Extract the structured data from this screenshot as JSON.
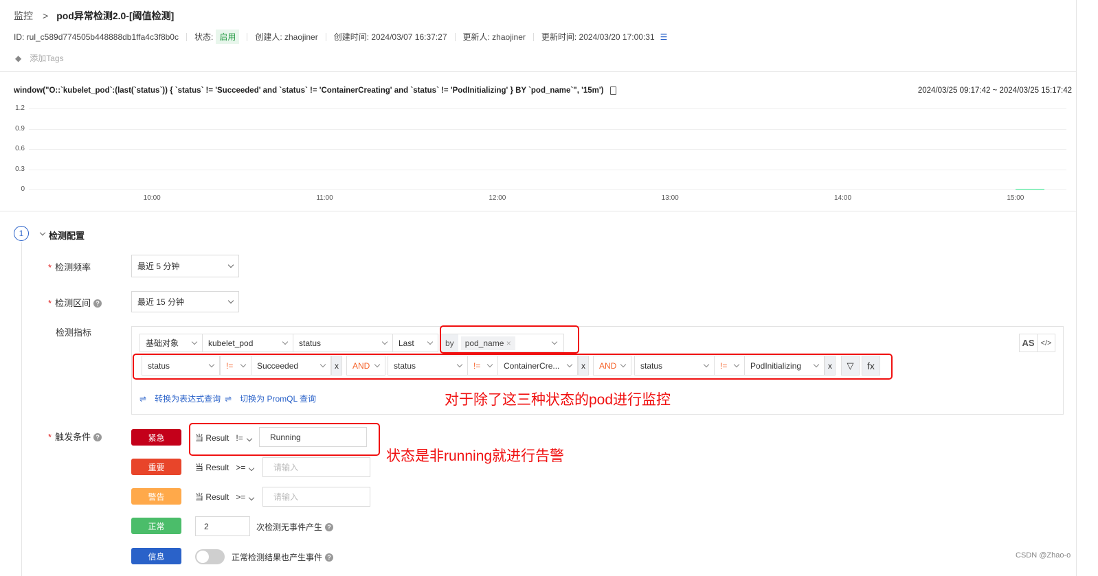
{
  "breadcrumb": {
    "parent": "监控",
    "separator": ">",
    "title": "pod异常检测2.0-[阈值检测]"
  },
  "meta": {
    "id": "ID: rul_c589d774505b448888db1ffa4c3f8b0c",
    "status_label": "状态:",
    "status_value": "启用",
    "creator": "创建人: zhaojiner",
    "created_time": "创建时间: 2024/03/07 16:37:27",
    "updater": "更新人: zhaojiner",
    "updated_time": "更新时间: 2024/03/20 17:00:31",
    "history_icon": "history-search-icon"
  },
  "tags": {
    "add_label": "添加Tags",
    "icon": "tag-icon"
  },
  "query": {
    "text": "window(\"O::`kubelet_pod`:(last(`status`)) { `status` != 'Succeeded' and `status` != 'ContainerCreating' and `status` != 'PodInitializing' } BY `pod_name`\", '15m')",
    "time_range": "2024/03/25 09:17:42 ~ 2024/03/25 15:17:42"
  },
  "chart_data": {
    "type": "line",
    "title": "",
    "xlabel": "",
    "ylabel": "",
    "ylim": [
      0,
      1.2
    ],
    "yticks": [
      "1.2",
      "0.9",
      "0.6",
      "0.3",
      "0"
    ],
    "xlim": [
      "09:17:42",
      "15:17:42"
    ],
    "xticks": [
      "10:00",
      "11:00",
      "12:00",
      "13:00",
      "14:00",
      "15:00"
    ],
    "grid": true,
    "series": [
      {
        "color": "#8ff0c0",
        "x": [
          "15:00",
          "15:10"
        ],
        "y": [
          0,
          0
        ]
      }
    ]
  },
  "section": {
    "number": "1",
    "title": "检测配置"
  },
  "form": {
    "freq": {
      "label": "检测频率",
      "value": "最近 5 分钟"
    },
    "range": {
      "label": "检测区间",
      "value": "最近 15 分钟"
    },
    "metric": {
      "label": "检测指标",
      "row1": [
        "基础对象",
        "kubelet_pod",
        "status",
        "Last"
      ],
      "by": "by",
      "by_tag": "pod_name",
      "filters": [
        {
          "field": "status",
          "op": "!=",
          "value": "Succeeded"
        },
        {
          "conj": "AND",
          "field": "status",
          "op": "!=",
          "value": "ContainerCre..."
        },
        {
          "conj": "AND",
          "field": "status",
          "op": "!=",
          "value": "PodInitializing"
        }
      ],
      "remove": "x",
      "fx": "fx",
      "as": "AS",
      "code": "</>",
      "link_expr": "转换为表达式查询",
      "link_promql": "切换为 PromQL 查询"
    },
    "trigger": {
      "label": "触发条件",
      "levels": [
        {
          "name": "紧急",
          "color": "#c4001a",
          "prefix": "当 Result",
          "op": "!=",
          "value": "Running",
          "placeholder": "请输入"
        },
        {
          "name": "重要",
          "color": "#e8452a",
          "prefix": "当 Result",
          "op": ">=",
          "value": "",
          "placeholder": "请输入"
        },
        {
          "name": "警告",
          "color": "#ffa94a",
          "prefix": "当 Result",
          "op": ">=",
          "value": "",
          "placeholder": "请输入"
        },
        {
          "name": "正常",
          "color": "#4bbd6a",
          "count": "2",
          "suffix": "次检测无事件产生"
        },
        {
          "name": "信息",
          "color": "#2a62c9",
          "toggle_label": "正常检测结果也产生事件",
          "toggle_on": false
        }
      ]
    }
  },
  "annotations": {
    "filter_note": "对于除了这三种状态的pod进行监控",
    "trigger_note": "状态是非running就进行告警"
  },
  "watermark": "CSDN @Zhao-o"
}
